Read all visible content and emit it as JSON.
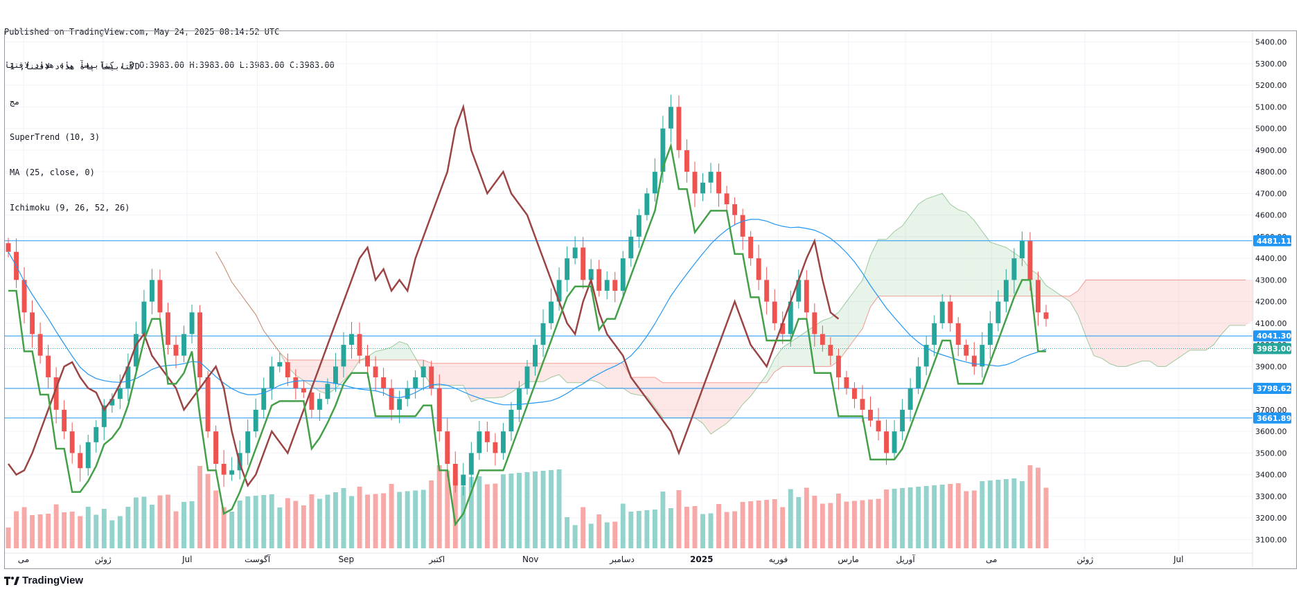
{
  "header": {
    "published": "Published on TradingView.com, May 24, 2025 08:14:52 UTC",
    "ohlc": "کتابیسآ پاه هداد لاقتنا , D O:3983.00 H:3983.00 L:3983.00 C:3983.00"
  },
  "legend": {
    "symbol": "کتابیسآ پاه هداد لاقتنا, 1D",
    "line2": "مج",
    "supertrend": "SuperTrend (10, 3)",
    "ma": "MA (25, close, 0)",
    "ichimoku": "Ichimoku (9, 26, 52, 26)"
  },
  "footer": {
    "brand": "TradingView"
  },
  "colors": {
    "up": "#26a69a",
    "down": "#ef5350",
    "vol_up": "#93d3cc",
    "vol_down": "#f7a9a7",
    "ma": "#2196f3",
    "supertrend_up": "#43a047",
    "lagging": "#9c4444",
    "level": "#2196f3",
    "last_price": "#26a69a"
  },
  "chart_data": {
    "type": "candlestick",
    "ylim": [
      3050,
      5450
    ],
    "y_ticks": [
      3100,
      3200,
      3300,
      3400,
      3500,
      3600,
      3700,
      3800,
      3900,
      4000,
      4100,
      4200,
      4300,
      4400,
      4500,
      4600,
      4700,
      4800,
      4900,
      5000,
      5100,
      5200,
      5300,
      5400
    ],
    "x_labels": [
      {
        "label": "می",
        "t": 0.02
      },
      {
        "label": "ژوئن",
        "t": 0.105
      },
      {
        "label": "Jul",
        "t": 0.195
      },
      {
        "label": "آگوست",
        "t": 0.27
      },
      {
        "label": "Sep",
        "t": 0.365
      },
      {
        "label": "اکتبر",
        "t": 0.462
      },
      {
        "label": "Nov",
        "t": 0.562
      },
      {
        "label": "دسامبر",
        "t": 0.66
      },
      {
        "label": "2025",
        "t": 0.745
      },
      {
        "label": "فوریه",
        "t": 0.827
      },
      {
        "label": "مارس",
        "t": 0.902
      },
      {
        "label": "آوریل",
        "t": 0.963
      },
      {
        "label": "می",
        "t": 1.055
      },
      {
        "label": "ژوئن",
        "t": 1.155
      },
      {
        "label": "Jul",
        "t": 1.255
      }
    ],
    "levels": [
      {
        "value": 4481.11,
        "label": "4481.11"
      },
      {
        "value": 4041.3,
        "label": "4041.30"
      },
      {
        "value": 3798.62,
        "label": "3798.62"
      },
      {
        "value": 3661.89,
        "label": "3661.89"
      }
    ],
    "last_price": {
      "value": 3983.0,
      "label": "3983.00"
    },
    "close_path": [
      4430,
      4300,
      4150,
      4050,
      3950,
      3850,
      3700,
      3600,
      3500,
      3430,
      3550,
      3620,
      3720,
      3750,
      3800,
      3900,
      4050,
      4200,
      4300,
      4150,
      4000,
      3950,
      4050,
      4150,
      3850,
      3600,
      3450,
      3400,
      3420,
      3500,
      3600,
      3700,
      3800,
      3900,
      3920,
      3850,
      3800,
      3780,
      3700,
      3750,
      3820,
      3900,
      4000,
      4050,
      3950,
      3900,
      3850,
      3800,
      3700,
      3750,
      3800,
      3850,
      3900,
      3800,
      3600,
      3450,
      3350,
      3400,
      3500,
      3600,
      3550,
      3500,
      3600,
      3700,
      3800,
      3900,
      4000,
      4100,
      4200,
      4300,
      4400,
      4450,
      4300,
      4350,
      4250,
      4300,
      4250,
      4400,
      4500,
      4600,
      4700,
      4800,
      5000,
      5100,
      4900,
      4800,
      4700,
      4750,
      4800,
      4700,
      4650,
      4600,
      4500,
      4400,
      4300,
      4200,
      4100,
      4050,
      4200,
      4300,
      4150,
      4050,
      4000,
      3950,
      3850,
      3800,
      3750,
      3700,
      3650,
      3600,
      3500,
      3600,
      3700,
      3800,
      3900,
      4000,
      4100,
      4200,
      4100,
      4000,
      3950,
      3900,
      4000,
      4100,
      4200,
      4300,
      4400,
      4480,
      4300,
      4150,
      4120
    ],
    "ma_series_note": "MA (25, close, 0)"
  }
}
